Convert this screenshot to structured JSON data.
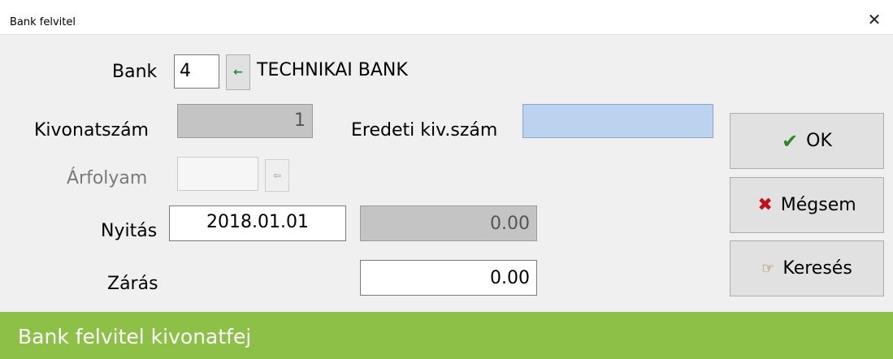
{
  "window": {
    "title": "Bank felvitel",
    "close_glyph": "✕"
  },
  "form": {
    "bank": {
      "label": "Bank",
      "code": "4",
      "lookup_glyph": "←",
      "name": "TECHNIKAI BANK"
    },
    "kivonatszam": {
      "label": "Kivonatszám",
      "value": "1"
    },
    "eredeti": {
      "label": "Eredeti kiv.szám",
      "value": ""
    },
    "arfolyam": {
      "label": "Árfolyam",
      "value": "",
      "lookup_glyph": "⇦"
    },
    "nyitas": {
      "label": "Nyitás",
      "date": "2018.01.01",
      "amount": "0.00"
    },
    "zaras": {
      "label": "Zárás",
      "amount": "0.00"
    }
  },
  "buttons": {
    "ok": {
      "icon": "✔",
      "label": "OK"
    },
    "cancel": {
      "icon": "✖",
      "label": "Mégsem"
    },
    "search": {
      "icon": "☞",
      "label": "Keresés"
    }
  },
  "footer": {
    "caption": "Bank felvitel kivonatfej"
  },
  "colors": {
    "footer_bg": "#8dc047",
    "ok_icon": "#2a8a1e",
    "cancel_icon": "#c0101a",
    "blue_field": "#bcd3ef",
    "lookup_green": "#1f8a2a"
  }
}
